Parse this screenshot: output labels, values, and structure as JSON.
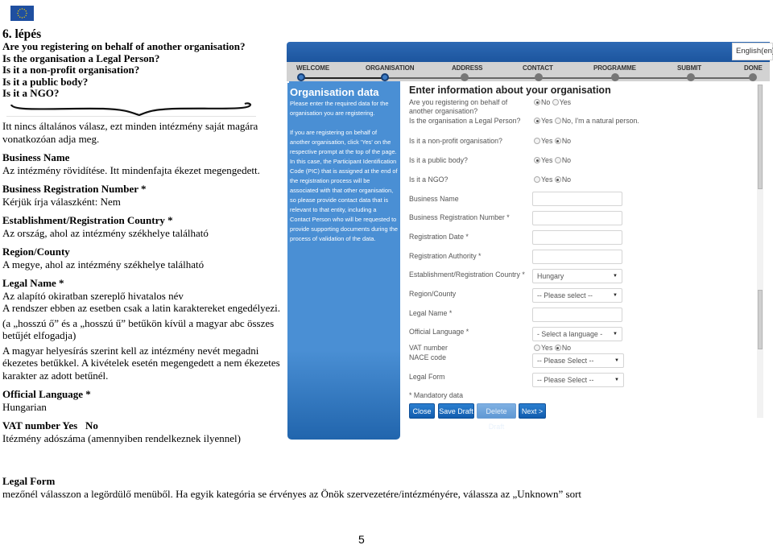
{
  "header": {
    "step_title": "6. lépés",
    "questions": [
      "Are you registering on behalf of another organisation?",
      "Is the organisation a Legal Person?",
      "Is it a non-profit organisation?",
      "Is it a public body?",
      "Is it a NGO?"
    ]
  },
  "explanations": {
    "intro": "Itt nincs általános válasz, ezt minden intézmény saját magára vonatkozóan adja meg.",
    "business_name": {
      "title": "Business Name",
      "text": "Az intézmény rövidítése. Itt mindenfajta ékezet megengedett."
    },
    "business_reg_number": {
      "title": "Business Registration Number *",
      "text": "Kérjük írja válaszként: Nem"
    },
    "country": {
      "title": "Establishment/Registration Country *",
      "text": "Az ország, ahol az intézmény székhelye található"
    },
    "region": {
      "title": "Region/County",
      "text": "A megye, ahol az intézmény székhelye található"
    },
    "legal_name": {
      "title": "Legal Name *",
      "lines": [
        "Az alapító okiratban szereplő hivatalos név",
        "A rendszer ebben az esetben csak a latin karaktereket engedélyezi.",
        "(a „hosszú ő” és a „hosszú ű” betűkön kívül a magyar abc összes betűjét elfogadja)",
        "A magyar helyesírás szerint kell az intézmény nevét megadni ékezetes betűkkel. A kivételek esetén megengedett a nem ékezetes karakter az adott betűnél."
      ]
    },
    "official_language": {
      "title": "Official Language *",
      "text": "Hungarian"
    },
    "vat": {
      "title": "VAT number Yes   No",
      "text": "Itézmény adószáma (amennyiben rendelkeznek ilyennel)"
    },
    "legal_form": {
      "title": "Legal Form",
      "text": "mezőnél válasszon a legördülő menüből. Ha egyik kategória se érvényes az Önök szervezetére/intézményére, válassza az „Unknown” sort"
    }
  },
  "page_number": "5",
  "screenshot": {
    "language": "English(en)",
    "steps": [
      {
        "label": "WELCOME",
        "done": true
      },
      {
        "label": "ORGANISATION",
        "done": true
      },
      {
        "label": "ADDRESS",
        "done": false
      },
      {
        "label": "CONTACT",
        "done": false
      },
      {
        "label": "PROGRAMME",
        "done": false
      },
      {
        "label": "SUBMIT",
        "done": false
      },
      {
        "label": "DONE",
        "done": false
      }
    ],
    "side_panel": {
      "title": "Organisation data",
      "text1": "Please enter the required data for the organisation you are registering.",
      "text2": "If you are registering on behalf of another organisation, click 'Yes' on the respective prompt at the top of the page. In this case, the Participant Identification Code (PIC) that is assigned at the end of the registration process will be associated with that other organisation, so please provide contact data that is relevant to that entity, including a Contact Person who will be requested to provide supporting documents during the process of validation of the data."
    },
    "form": {
      "heading": "Enter information about your organisation",
      "radios": [
        {
          "label": "Are you registering on behalf of another organisation?",
          "opt1": "No",
          "opt2": "Yes",
          "selected": "No"
        },
        {
          "label": "Is the organisation a Legal Person?",
          "opt1": "Yes",
          "opt2": "No, I'm a natural person.",
          "selected": "Yes"
        },
        {
          "label": "Is it a non-profit organisation?",
          "opt1": "Yes",
          "opt2": "No",
          "selected": "No"
        },
        {
          "label": "Is it a public body?",
          "opt1": "Yes",
          "opt2": "No",
          "selected": "Yes"
        },
        {
          "label": "Is it a NGO?",
          "opt1": "Yes",
          "opt2": "No",
          "selected": "No"
        }
      ],
      "fields": {
        "business_name": {
          "label": "Business Name",
          "value": ""
        },
        "business_reg_number": {
          "label": "Business Registration Number *",
          "value": ""
        },
        "registration_date": {
          "label": "Registration Date *",
          "value": ""
        },
        "registration_authority": {
          "label": "Registration Authority *",
          "value": ""
        },
        "country": {
          "label": "Establishment/Registration Country *",
          "value": "Hungary"
        },
        "region": {
          "label": "Region/County",
          "value": "-- Please select --"
        },
        "legal_name": {
          "label": "Legal Name *",
          "value": ""
        },
        "official_language": {
          "label": "Official Language *",
          "value": "- Select a language -"
        },
        "vat": {
          "label": "VAT number",
          "opt1": "Yes",
          "opt2": "No",
          "selected": "No"
        },
        "nace": {
          "label": "NACE code",
          "value": "-- Please Select --"
        },
        "legal_form": {
          "label": "Legal Form",
          "value": "-- Please Select --"
        }
      },
      "mandatory_note": "* Mandatory data",
      "buttons": {
        "close": "Close",
        "save_draft": "Save Draft",
        "delete_draft": "Delete Draft",
        "next": "Next >"
      }
    }
  }
}
